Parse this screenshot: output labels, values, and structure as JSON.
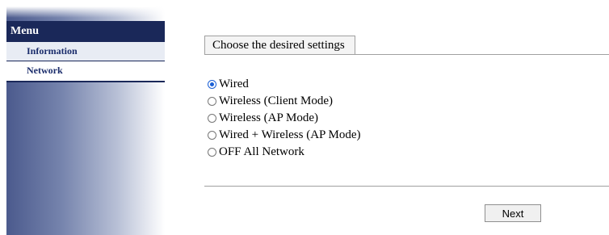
{
  "sidebar": {
    "header": "Menu",
    "items": [
      {
        "label": "Information",
        "selected": true
      },
      {
        "label": "Network",
        "selected": false
      }
    ]
  },
  "main": {
    "tab_label": "Choose the desired settings",
    "options": [
      {
        "label": "Wired",
        "checked": true
      },
      {
        "label": "Wireless (Client Mode)",
        "checked": false
      },
      {
        "label": "Wireless (AP Mode)",
        "checked": false
      },
      {
        "label": "Wired + Wireless (AP Mode)",
        "checked": false
      },
      {
        "label": "OFF All Network",
        "checked": false
      }
    ],
    "next_label": "Next"
  },
  "colors": {
    "menu_header_bg": "#1a2859",
    "menu_text": "#1a2c6b",
    "radio_accent": "#1a5fd6"
  }
}
